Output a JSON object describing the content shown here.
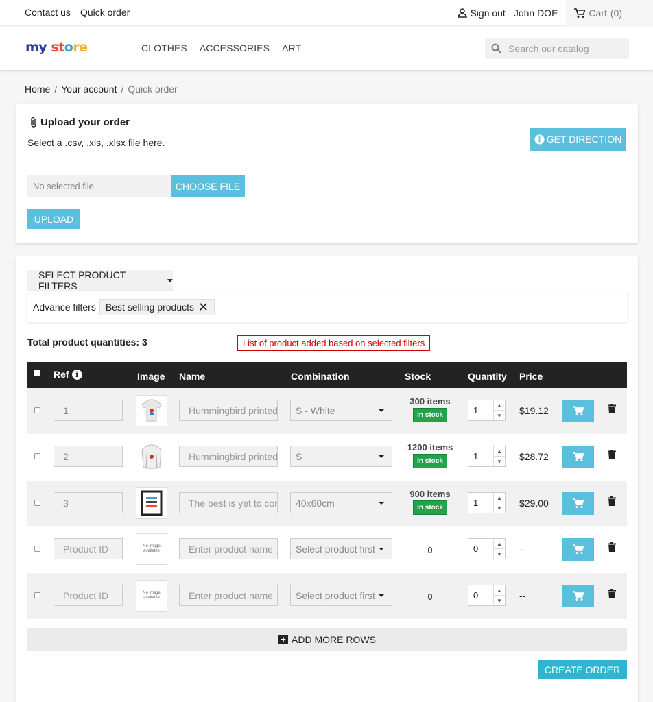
{
  "topbar": {
    "contact": "Contact us",
    "quick_order": "Quick order",
    "sign_out": "Sign out",
    "user": "John DOE",
    "cart": "Cart",
    "cart_count": "(0)"
  },
  "header": {
    "logo": [
      "my ",
      "st",
      "o",
      "re"
    ],
    "nav": [
      "Clothes",
      "Accessories",
      "Art"
    ],
    "search_placeholder": "Search our catalog"
  },
  "breadcrumb": {
    "items": [
      "Home",
      "Your account",
      "Quick order"
    ],
    "separator": "/"
  },
  "upload": {
    "title": "Upload your order",
    "subtitle": "Select a .csv, .xls, .xlsx file here.",
    "direction_label": "Get direction",
    "file_placeholder": "No selected file",
    "choose_label": "Choose file",
    "upload_label": "Upload"
  },
  "filters": {
    "button_label": "Select product filters",
    "advance_label": "Advance filters",
    "chip_label": "Best selling products",
    "chip_remove": "✕"
  },
  "summary": {
    "total": "Total product quantities: 3",
    "notice": "List of product added based on selected filters"
  },
  "table": {
    "headers": [
      "Ref",
      "Image",
      "Name",
      "Combination",
      "Stock",
      "Quantity",
      "Price"
    ],
    "rows": [
      {
        "ref": "1",
        "name": "Hummingbird printed t-shirt",
        "combination": "S - White",
        "stock": "300 items",
        "badge": "In stock",
        "qty": "1",
        "price": "$19.12",
        "image": "tshirt"
      },
      {
        "ref": "2",
        "name": "Hummingbird printed sweater",
        "combination": "S",
        "stock": "1200 items",
        "badge": "In stock",
        "qty": "1",
        "price": "$28.72",
        "image": "sweater"
      },
      {
        "ref": "3",
        "name": "The best is yet to come framed poster",
        "combination": "40x60cm",
        "stock": "900 items",
        "badge": "In stock",
        "qty": "1",
        "price": "$29.00",
        "image": "poster"
      },
      {
        "ref": "Product ID",
        "name": "Enter product name",
        "combination": "Select product first",
        "stock": "0",
        "badge": "",
        "qty": "0",
        "price": "--",
        "image": "none"
      },
      {
        "ref": "Product ID",
        "name": "Enter product name",
        "combination": "Select product first",
        "stock": "0",
        "badge": "",
        "qty": "0",
        "price": "--",
        "image": "none"
      }
    ],
    "no_image_text": "No image available"
  },
  "actions": {
    "add_rows": "Add more rows",
    "create_order": "Create order"
  },
  "colors": {
    "accent": "#5bc0de",
    "primary": "#2fb5d2",
    "in_stock": "#21a44a",
    "notice": "#cc0000"
  }
}
